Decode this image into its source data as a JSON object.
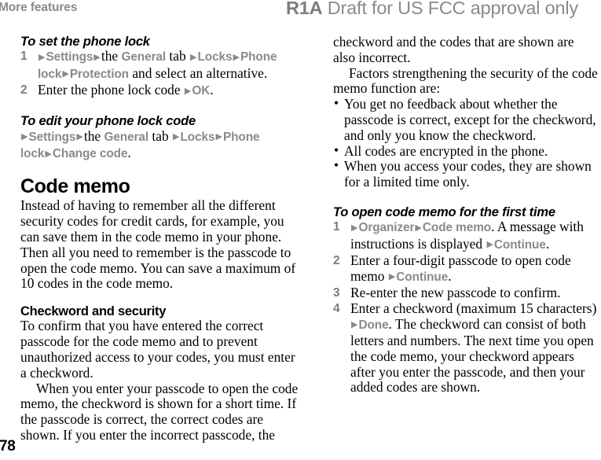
{
  "header": {
    "running_title": "More features",
    "revision": "R1A",
    "draft_notice": "Draft for US FCC approval only",
    "header_color": "#8a8a8a"
  },
  "folio": {
    "page_number": "78"
  },
  "ui_token_color": "#8a8a8a",
  "arrow_glyph": "▶",
  "bullet_glyph": "•",
  "left_column": {
    "task1": {
      "heading": "To set the phone lock",
      "steps": [
        {
          "number": "1",
          "parts": [
            {
              "t": "arrow"
            },
            {
              "t": "ui",
              "v": "Settings"
            },
            {
              "t": "arrow"
            },
            {
              "t": "txt",
              "v": "the "
            },
            {
              "t": "ui",
              "v": "General"
            },
            {
              "t": "txt",
              "v": " tab "
            },
            {
              "t": "arrow"
            },
            {
              "t": "ui",
              "v": "Locks"
            },
            {
              "t": "arrow"
            },
            {
              "t": "ui",
              "v": "Phone lock"
            },
            {
              "t": "arrow"
            },
            {
              "t": "ui",
              "v": "Protection"
            },
            {
              "t": "txt",
              "v": " and select an alternative."
            }
          ]
        },
        {
          "number": "2",
          "parts": [
            {
              "t": "txt",
              "v": "Enter the phone lock code "
            },
            {
              "t": "arrow"
            },
            {
              "t": "ui",
              "v": "OK"
            },
            {
              "t": "txt",
              "v": "."
            }
          ]
        }
      ]
    },
    "task2": {
      "heading": "To edit your phone lock code",
      "step_parts": [
        {
          "t": "arrow"
        },
        {
          "t": "ui",
          "v": "Settings"
        },
        {
          "t": "arrow"
        },
        {
          "t": "txt",
          "v": "the "
        },
        {
          "t": "ui",
          "v": "General"
        },
        {
          "t": "txt",
          "v": " tab "
        },
        {
          "t": "arrow"
        },
        {
          "t": "ui",
          "v": "Locks"
        },
        {
          "t": "arrow"
        },
        {
          "t": "ui",
          "v": "Phone lock"
        },
        {
          "t": "arrow"
        },
        {
          "t": "ui",
          "v": "Change code"
        },
        {
          "t": "txt",
          "v": "."
        }
      ]
    },
    "section": {
      "heading": "Code memo",
      "paragraph": "Instead of having to remember all the different security codes for credit cards, for example, you can save them in the code memo in your phone. Then all you need to remember is the passcode to open the code memo. You can save a maximum of 10 codes in the code memo."
    },
    "subsection": {
      "heading": "Checkword and security",
      "paragraph1": "To confirm that you have entered the correct passcode for the code memo and to prevent unauthorized access to your codes, you must enter a checkword.",
      "paragraph2": "When you enter your passcode to open the code memo, the checkword is shown for a short time. If the passcode is correct, the correct codes are shown. If you enter the incorrect passcode, the"
    }
  },
  "right_column": {
    "continued_paragraph": "checkword and the codes that are shown are also incorrect.",
    "factors_paragraph": "Factors strengthening the security of the code memo function are:",
    "bullets": [
      "You get no feedback about whether the passcode is correct, except for the checkword, and only you know the checkword.",
      "All codes are encrypted in the phone.",
      "When you access your codes, they are shown for a limited time only."
    ],
    "task": {
      "heading": "To open code memo for the first time",
      "steps": [
        {
          "number": "1",
          "parts": [
            {
              "t": "arrow"
            },
            {
              "t": "ui",
              "v": "Organizer"
            },
            {
              "t": "arrow"
            },
            {
              "t": "ui",
              "v": "Code memo"
            },
            {
              "t": "txt",
              "v": ". A message with instructions is displayed "
            },
            {
              "t": "arrow"
            },
            {
              "t": "ui",
              "v": "Continue"
            },
            {
              "t": "txt",
              "v": "."
            }
          ]
        },
        {
          "number": "2",
          "parts": [
            {
              "t": "txt",
              "v": "Enter a four-digit passcode to open code memo "
            },
            {
              "t": "arrow"
            },
            {
              "t": "ui",
              "v": "Continue"
            },
            {
              "t": "txt",
              "v": "."
            }
          ]
        },
        {
          "number": "3",
          "parts": [
            {
              "t": "txt",
              "v": "Re-enter the new passcode to confirm."
            }
          ]
        },
        {
          "number": "4",
          "parts": [
            {
              "t": "txt",
              "v": "Enter a checkword (maximum 15 characters) "
            },
            {
              "t": "arrow"
            },
            {
              "t": "ui",
              "v": "Done"
            },
            {
              "t": "txt",
              "v": ". The checkword can consist of both letters and numbers. The next time you open the code memo, your checkword appears after you enter the passcode, and then your added codes are shown."
            }
          ]
        }
      ]
    }
  }
}
